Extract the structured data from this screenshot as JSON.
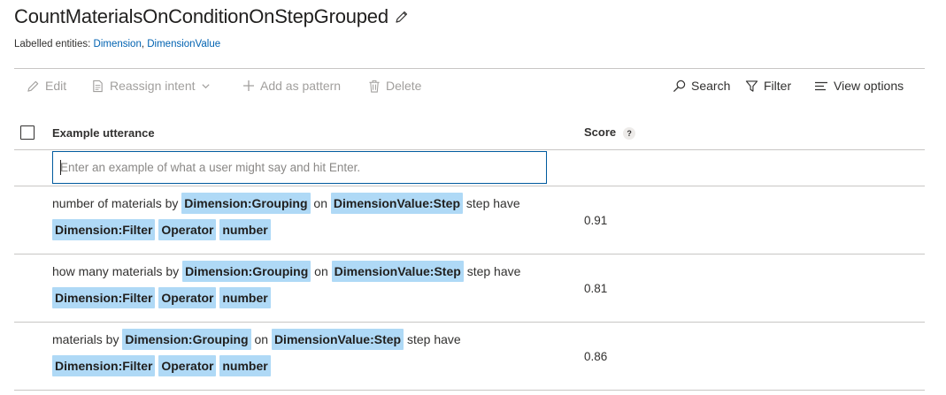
{
  "intent": {
    "title": "CountMaterialsOnConditionOnStepGrouped",
    "labelled_prefix": "Labelled entities: ",
    "entity_links": [
      "Dimension",
      "DimensionValue"
    ],
    "separator": ", "
  },
  "toolbar": {
    "edit": "Edit",
    "reassign": "Reassign intent",
    "add_pattern": "Add as pattern",
    "delete": "Delete",
    "search": "Search",
    "filter": "Filter",
    "view_options": "View options"
  },
  "table": {
    "col_utterance": "Example utterance",
    "col_score": "Score",
    "score_help": "?",
    "input_placeholder": "Enter an example of what a user might say and hit Enter."
  },
  "utterances": [
    {
      "score": "0.91",
      "tokens": [
        {
          "t": "number of materials by",
          "e": false
        },
        {
          "t": "Dimension:Grouping",
          "e": true
        },
        {
          "t": "on",
          "e": false
        },
        {
          "t": "DimensionValue:Step",
          "e": true
        },
        {
          "t": "step have",
          "e": false
        },
        {
          "t": "Dimension:Filter",
          "e": true
        },
        {
          "t": "Operator",
          "e": true
        },
        {
          "t": "number",
          "e": true
        }
      ]
    },
    {
      "score": "0.81",
      "tokens": [
        {
          "t": "how many materials by",
          "e": false
        },
        {
          "t": "Dimension:Grouping",
          "e": true
        },
        {
          "t": "on",
          "e": false
        },
        {
          "t": "DimensionValue:Step",
          "e": true
        },
        {
          "t": "step have",
          "e": false
        },
        {
          "t": "Dimension:Filter",
          "e": true
        },
        {
          "t": "Operator",
          "e": true
        },
        {
          "t": "number",
          "e": true
        }
      ]
    },
    {
      "score": "0.86",
      "tokens": [
        {
          "t": "materials by",
          "e": false
        },
        {
          "t": "Dimension:Grouping",
          "e": true
        },
        {
          "t": "on",
          "e": false
        },
        {
          "t": "DimensionValue:Step",
          "e": true
        },
        {
          "t": "step have",
          "e": false
        },
        {
          "t": "Dimension:Filter",
          "e": true
        },
        {
          "t": "Operator",
          "e": true
        },
        {
          "t": "number",
          "e": true
        }
      ]
    }
  ],
  "colors": {
    "entity_chip": "#afd9f6",
    "link": "#0062b1",
    "input_border": "#005a9e",
    "disabled_text": "#a19f9d"
  }
}
